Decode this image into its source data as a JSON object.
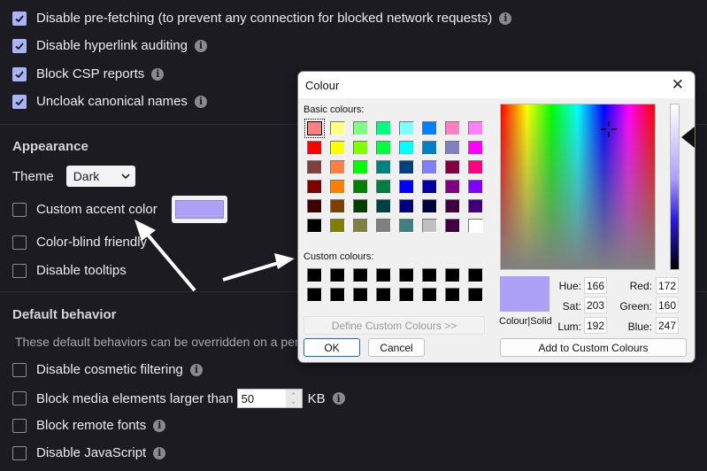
{
  "privacy": {
    "items": [
      {
        "label": "Disable pre-fetching (to prevent any connection for blocked network requests)",
        "checked": true
      },
      {
        "label": "Disable hyperlink auditing",
        "checked": true
      },
      {
        "label": "Block CSP reports",
        "checked": true
      },
      {
        "label": "Uncloak canonical names",
        "checked": true
      }
    ]
  },
  "appearance": {
    "title": "Appearance",
    "theme_label": "Theme",
    "theme_value": "Dark",
    "items": [
      {
        "label": "Custom accent color",
        "checked": false
      },
      {
        "label": "Color-blind friendly",
        "checked": false
      },
      {
        "label": "Disable tooltips",
        "checked": false
      }
    ],
    "accent_color": "#aca0f7"
  },
  "default_behavior": {
    "title": "Default behavior",
    "description": "These default behaviors can be overridden on a per-",
    "items": [
      {
        "label": "Disable cosmetic filtering",
        "checked": false
      },
      {
        "label": "Block media elements larger than",
        "checked": false,
        "value": "50",
        "unit": "KB"
      },
      {
        "label": "Block remote fonts",
        "checked": false
      },
      {
        "label": "Disable JavaScript",
        "checked": false
      }
    ]
  },
  "colour_dialog": {
    "title": "Colour",
    "basic_label": "Basic colours:",
    "custom_label": "Custom colours:",
    "define_button": "Define Custom Colours >>",
    "ok_button": "OK",
    "cancel_button": "Cancel",
    "add_button": "Add to Custom Colours",
    "colour_solid_label": "Colour|Solid",
    "basic_colours": [
      "#ff8080",
      "#ffff80",
      "#80ff80",
      "#00ff80",
      "#80ffff",
      "#0080ff",
      "#ff80c0",
      "#ff80ff",
      "#ff0000",
      "#ffff00",
      "#80ff00",
      "#00ff40",
      "#00ffff",
      "#0080c0",
      "#8080c0",
      "#ff00ff",
      "#804040",
      "#ff8040",
      "#00ff00",
      "#008080",
      "#004080",
      "#8080ff",
      "#800040",
      "#ff0080",
      "#800000",
      "#ff8000",
      "#008000",
      "#008040",
      "#0000ff",
      "#0000a0",
      "#800080",
      "#8000ff",
      "#400000",
      "#804000",
      "#004000",
      "#004040",
      "#000080",
      "#000040",
      "#400040",
      "#400080",
      "#000000",
      "#808000",
      "#808040",
      "#808080",
      "#408080",
      "#c0c0c0",
      "#400040",
      "#ffffff"
    ],
    "custom_colours": [
      "#000000",
      "#000000",
      "#000000",
      "#000000",
      "#000000",
      "#000000",
      "#000000",
      "#000000",
      "#000000",
      "#000000",
      "#000000",
      "#000000",
      "#000000",
      "#000000",
      "#000000",
      "#000000"
    ],
    "selected_basic_index": 0,
    "current_colour": "#aca0f7",
    "fields": {
      "hue_label": "Hue:",
      "hue": "166",
      "sat_label": "Sat:",
      "sat": "203",
      "lum_label": "Lum:",
      "lum": "192",
      "red_label": "Red:",
      "red": "172",
      "green_label": "Green:",
      "green": "160",
      "blue_label": "Blue:",
      "blue": "247"
    }
  }
}
